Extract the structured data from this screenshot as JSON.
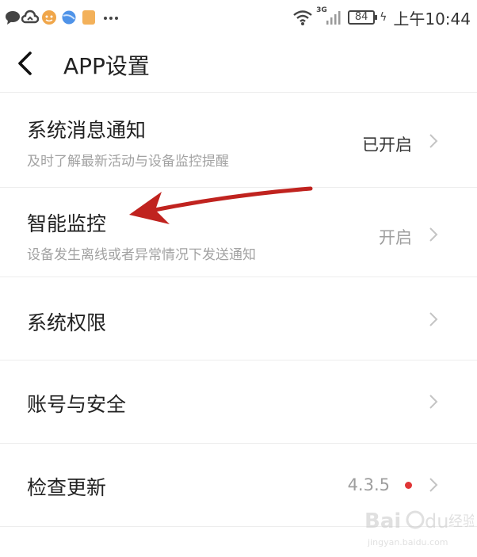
{
  "status_bar": {
    "network": "3G",
    "battery": "84",
    "time": "上午10:44"
  },
  "header": {
    "title": "APP设置"
  },
  "rows": [
    {
      "title": "系统消息通知",
      "subtitle": "及时了解最新活动与设备监控提醒",
      "value": "已开启"
    },
    {
      "title": "智能监控",
      "subtitle": "设备发生离线或者异常情况下发送通知",
      "value": "开启"
    },
    {
      "title": "系统权限"
    },
    {
      "title": "账号与安全"
    },
    {
      "title": "检查更新",
      "value": "4.3.5"
    }
  ],
  "colors": {
    "annotation_arrow": "#c0231f",
    "update_dot": "#e03536",
    "secondary_text": "#a2a2a2"
  },
  "watermark": {
    "logo": "Bai du 经验",
    "url": "jingyan.baidu.com"
  }
}
